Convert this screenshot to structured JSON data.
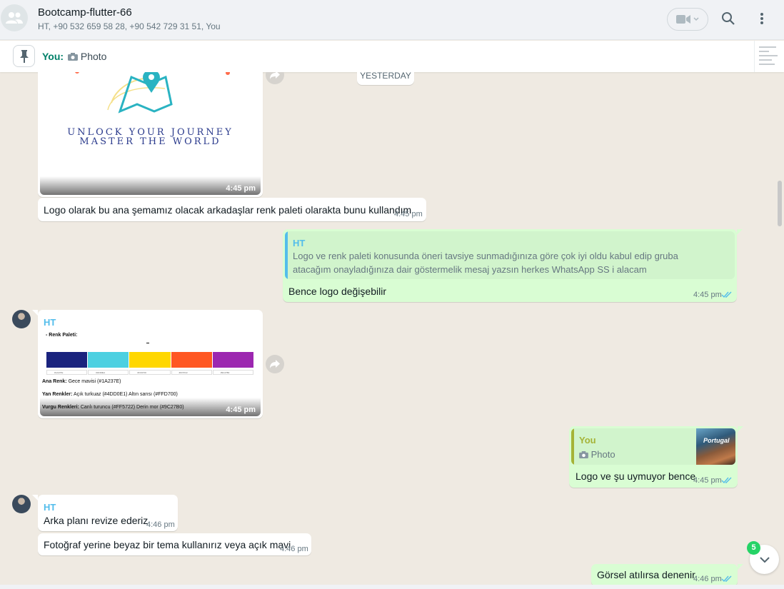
{
  "header": {
    "title": "Bootcamp-flutter-66",
    "participants": "HT, +90 532 659 58 28, +90 542 729 31 51, You"
  },
  "pinned": {
    "sender": "You:",
    "label": "Photo"
  },
  "date_separator": "YESTERDAY",
  "messages": {
    "m1": {
      "image_text_line1": "UNLOCK YOUR JOURNEY",
      "image_text_line2": "MASTER THE WORLD",
      "time": "4:45 pm"
    },
    "m2": {
      "text": "Logo olarak bu ana şemamız olacak arkadaşlar renk paleti olarakta bunu kullandım",
      "time": "4:45 pm"
    },
    "m3": {
      "quote_sender": "HT",
      "quote_line1": "Logo ve renk paleti konusunda öneri tavsiye sunmadığınıza göre çok iyi oldu kabul edip gruba",
      "quote_line2": "atacağım onayladığınıza dair göstermelik mesaj yazsın herkes WhatsApp SS i alacam",
      "text": "Bence logo değişebilir",
      "time": "4:45 pm"
    },
    "m4": {
      "sender": "HT",
      "palette_title": "- Renk Paleti:",
      "swatches": [
        {
          "color": "#1A237E",
          "label": "#1A237E"
        },
        {
          "color": "#4DD0E1",
          "label": "#4DD0E1"
        },
        {
          "color": "#FFD700",
          "label": "#FFD700"
        },
        {
          "color": "#FF5722",
          "label": "#FF5722"
        },
        {
          "color": "#9C27B0",
          "label": "#9C27B0"
        }
      ],
      "ana_label": "Ana Renk:",
      "ana_value": "Gece mavisi (#1A237E)",
      "yan_label": "Yan Renkler:",
      "yan_value": "Açık turkuaz (#4DD0E1) Altın sarısı (#FFD700)",
      "vurgu_label": "Vurgu Renkleri:",
      "vurgu_value": "Canlı turuncu (#FF5722) Derin mor (#9C27B0)",
      "time": "4:45 pm"
    },
    "m5": {
      "quote_sender": "You",
      "quote_label": "Photo",
      "thumb_text": "Portugal",
      "text": "Logo ve şu uymuyor bence",
      "time": "4:45 pm"
    },
    "m6": {
      "sender": "HT",
      "text": "Arka planı revize ederiz",
      "time": "4:46 pm"
    },
    "m7": {
      "text": "Fotoğraf yerine beyaz bir tema kullanırız veya açık mavi",
      "time": "4:46 pm"
    },
    "m8": {
      "text": "Görsel atılırsa denenir",
      "time": "4:46 pm"
    }
  },
  "unread_count": "5",
  "colors": {
    "chat_bg": "#efeae2",
    "outgoing": "#d9fdd3",
    "incoming": "#ffffff",
    "accent": "#008069",
    "sender_ht": "#53bdeb",
    "sender_you": "#a5b337",
    "read_ticks": "#53bdeb"
  },
  "icons": [
    "group-icon",
    "video-icon",
    "search-icon",
    "menu-icon",
    "pin-icon",
    "camera-icon",
    "forward-icon",
    "double-check-icon",
    "chevron-down-icon"
  ]
}
